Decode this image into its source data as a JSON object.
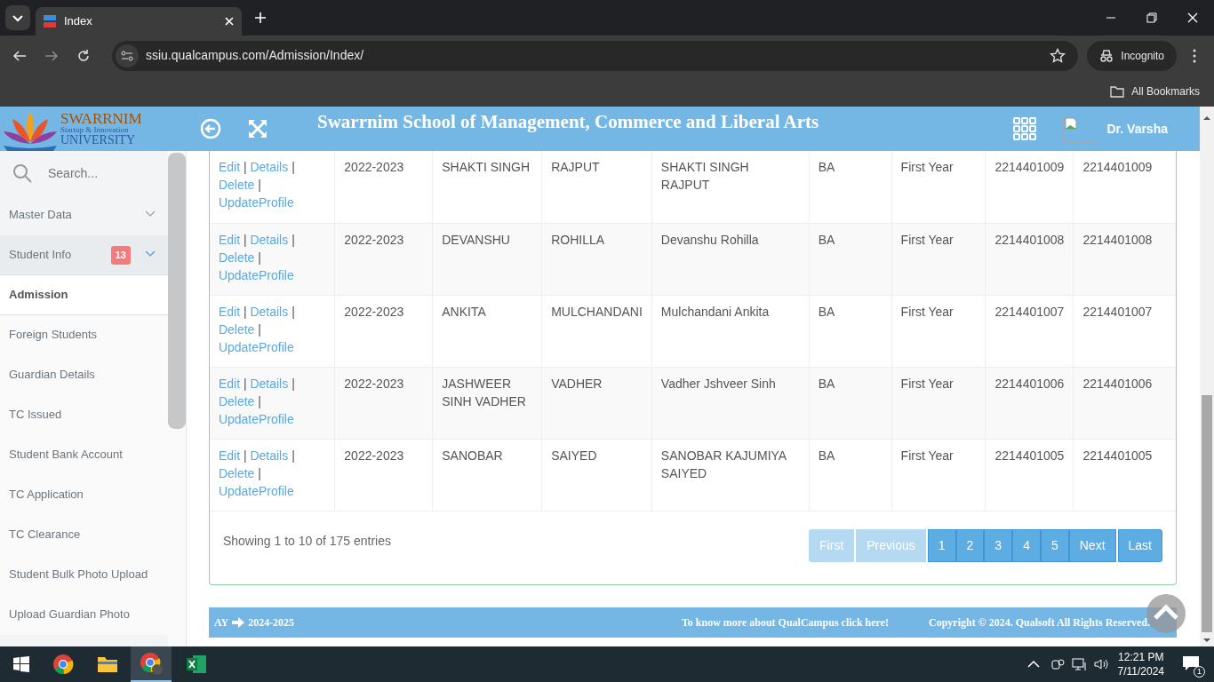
{
  "browser": {
    "tab_title": "Index",
    "url": "ssiu.qualcampus.com/Admission/Index/",
    "profile": "Incognito",
    "bookmarks": "All Bookmarks"
  },
  "header": {
    "logo_lines": [
      "SWARRNIM",
      "Startup & Innovation",
      "UNIVERSITY"
    ],
    "title": "Swarrnim School of Management, Commerce and Liberal Arts",
    "user": "Dr. Varsha"
  },
  "sidebar": {
    "search_placeholder": "Search...",
    "items": [
      {
        "label": "Master Data",
        "kind": "group",
        "expanded": false
      },
      {
        "label": "Student Info",
        "kind": "group",
        "expanded": true,
        "badge": "13"
      },
      {
        "label": "Admission",
        "kind": "link",
        "selected": true
      },
      {
        "label": "Foreign Students",
        "kind": "link",
        "selected": false
      },
      {
        "label": "Guardian Details",
        "kind": "link",
        "selected": false
      },
      {
        "label": "TC Issued",
        "kind": "link",
        "selected": false
      },
      {
        "label": "Student Bank Account",
        "kind": "link",
        "selected": false
      },
      {
        "label": "TC Application",
        "kind": "link",
        "selected": false
      },
      {
        "label": "TC Clearance",
        "kind": "link",
        "selected": false
      },
      {
        "label": "Student Bulk Photo Upload",
        "kind": "link",
        "selected": false
      },
      {
        "label": "Upload Guardian Photo",
        "kind": "link",
        "selected": false
      }
    ]
  },
  "table": {
    "rows": [
      {
        "actions": [
          "Edit",
          "|",
          "Details",
          "|",
          "Delete",
          "|",
          "UpdateProfile"
        ],
        "cells": [
          "2022-2023",
          "SHAKTI SINGH",
          "RAJPUT",
          "SHAKTI SINGH RAJPUT",
          "BA",
          "First Year",
          "2214401009",
          "2214401009"
        ]
      },
      {
        "actions": [
          "Edit",
          "|",
          "Details",
          "|",
          "Delete",
          "|",
          "UpdateProfile"
        ],
        "cells": [
          "2022-2023",
          "DEVANSHU",
          "ROHILLA",
          "Devanshu Rohilla",
          "BA",
          "First Year",
          "2214401008",
          "2214401008"
        ]
      },
      {
        "actions": [
          "Edit",
          "|",
          "Details",
          "|",
          "Delete",
          "|",
          "UpdateProfile"
        ],
        "cells": [
          "2022-2023",
          "ANKITA",
          "MULCHANDANI",
          "Mulchandani Ankita",
          "BA",
          "First Year",
          "2214401007",
          "2214401007"
        ]
      },
      {
        "actions": [
          "Edit",
          "|",
          "Details",
          "|",
          "Delete",
          "|",
          "UpdateProfile"
        ],
        "cells": [
          "2022-2023",
          "JASHWEER SINH VADHER",
          "VADHER",
          "Vadher Jshveer Sinh",
          "BA",
          "First Year",
          "2214401006",
          "2214401006"
        ]
      },
      {
        "actions": [
          "Edit",
          "|",
          "Details",
          "|",
          "Delete",
          "|",
          "UpdateProfile"
        ],
        "cells": [
          "2022-2023",
          "SANOBAR",
          "SAIYED",
          "SANOBAR KAJUMIYA SAIYED",
          "BA",
          "First Year",
          "2214401005",
          "2214401005"
        ]
      }
    ],
    "info": "Showing 1 to 10 of 175 entries",
    "pagination": [
      {
        "label": "First",
        "disabled": true
      },
      {
        "label": "Previous",
        "disabled": true
      },
      {
        "label": "1",
        "disabled": false
      },
      {
        "label": "2",
        "disabled": false
      },
      {
        "label": "3",
        "disabled": false
      },
      {
        "label": "4",
        "disabled": false
      },
      {
        "label": "5",
        "disabled": false
      },
      {
        "label": "Next",
        "disabled": false
      },
      {
        "label": "Last",
        "disabled": false
      }
    ]
  },
  "footer": {
    "ay_label": "AY",
    "ay_value": "2024-2025",
    "link": "To know more about QualCampus click here!",
    "copyright": "Copyright © 2024. Qualsoft All Rights Reserved."
  },
  "taskbar": {
    "time": "12:21 PM",
    "date": "7/11/2024",
    "notifications": "1"
  }
}
